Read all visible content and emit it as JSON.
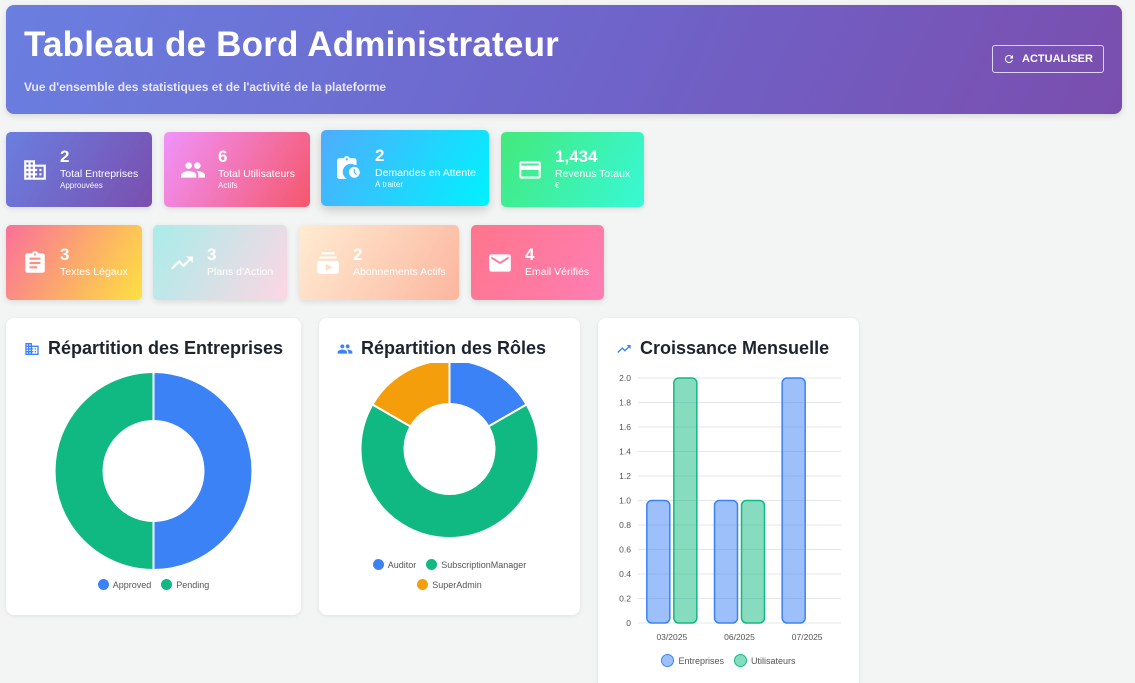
{
  "header": {
    "title": "Tableau de Bord Administrateur",
    "subtitle": "Vue d'ensemble des statistiques et de l'activité de la plateforme",
    "refresh_label": "ACTUALISER"
  },
  "stats_row1": [
    {
      "value": "2",
      "label": "Total Entreprises",
      "sub": "Approuvées",
      "icon": "building-icon"
    },
    {
      "value": "6",
      "label": "Total Utilisateurs",
      "sub": "Actifs",
      "icon": "users-icon"
    },
    {
      "value": "2",
      "label": "Demandes en Attente",
      "sub": "À traiter",
      "icon": "clipboard-clock-icon"
    },
    {
      "value": "1,434",
      "label": "Revenus Totaux",
      "sub": "€",
      "icon": "credit-card-icon"
    }
  ],
  "stats_row2": [
    {
      "value": "3",
      "label": "Textes Légaux",
      "icon": "assignment-icon"
    },
    {
      "value": "3",
      "label": "Plans d'Action",
      "icon": "trending-up-icon"
    },
    {
      "value": "2",
      "label": "Abonnements Actifs",
      "icon": "subscriptions-icon"
    },
    {
      "value": "4",
      "label": "Email Vérifiés",
      "icon": "email-icon"
    }
  ],
  "panels": {
    "entreprises": {
      "title": "Répartition des Entreprises"
    },
    "roles": {
      "title": "Répartition des Rôles"
    },
    "croissance": {
      "title": "Croissance Mensuelle"
    }
  },
  "colors": {
    "blue": "#3b82f6",
    "green": "#10b981",
    "orange": "#f59e0b"
  },
  "chart_data": [
    {
      "type": "pie",
      "title": "Répartition des Entreprises",
      "labels": [
        "Approved",
        "Pending"
      ],
      "values": [
        1,
        1
      ],
      "colors": [
        "#3b82f6",
        "#10b981"
      ],
      "legend": "bottom"
    },
    {
      "type": "pie",
      "title": "Répartition des Rôles",
      "labels": [
        "Auditor",
        "SubscriptionManager",
        "SuperAdmin"
      ],
      "values": [
        1,
        4,
        1
      ],
      "colors": [
        "#3b82f6",
        "#10b981",
        "#f59e0b"
      ],
      "legend": "bottom"
    },
    {
      "type": "bar",
      "title": "Croissance Mensuelle",
      "categories": [
        "03/2025",
        "06/2025",
        "07/2025"
      ],
      "series": [
        {
          "name": "Entreprises",
          "values": [
            1,
            1,
            2
          ]
        },
        {
          "name": "Utilisateurs",
          "values": [
            2,
            1,
            0
          ]
        }
      ],
      "ylim": [
        0,
        2
      ],
      "yticks": [
        "0",
        "0.2",
        "0.4",
        "0.6",
        "0.8",
        "1.0",
        "1.2",
        "1.4",
        "1.6",
        "1.8",
        "2.0"
      ],
      "grid": true,
      "legend": "bottom"
    }
  ]
}
